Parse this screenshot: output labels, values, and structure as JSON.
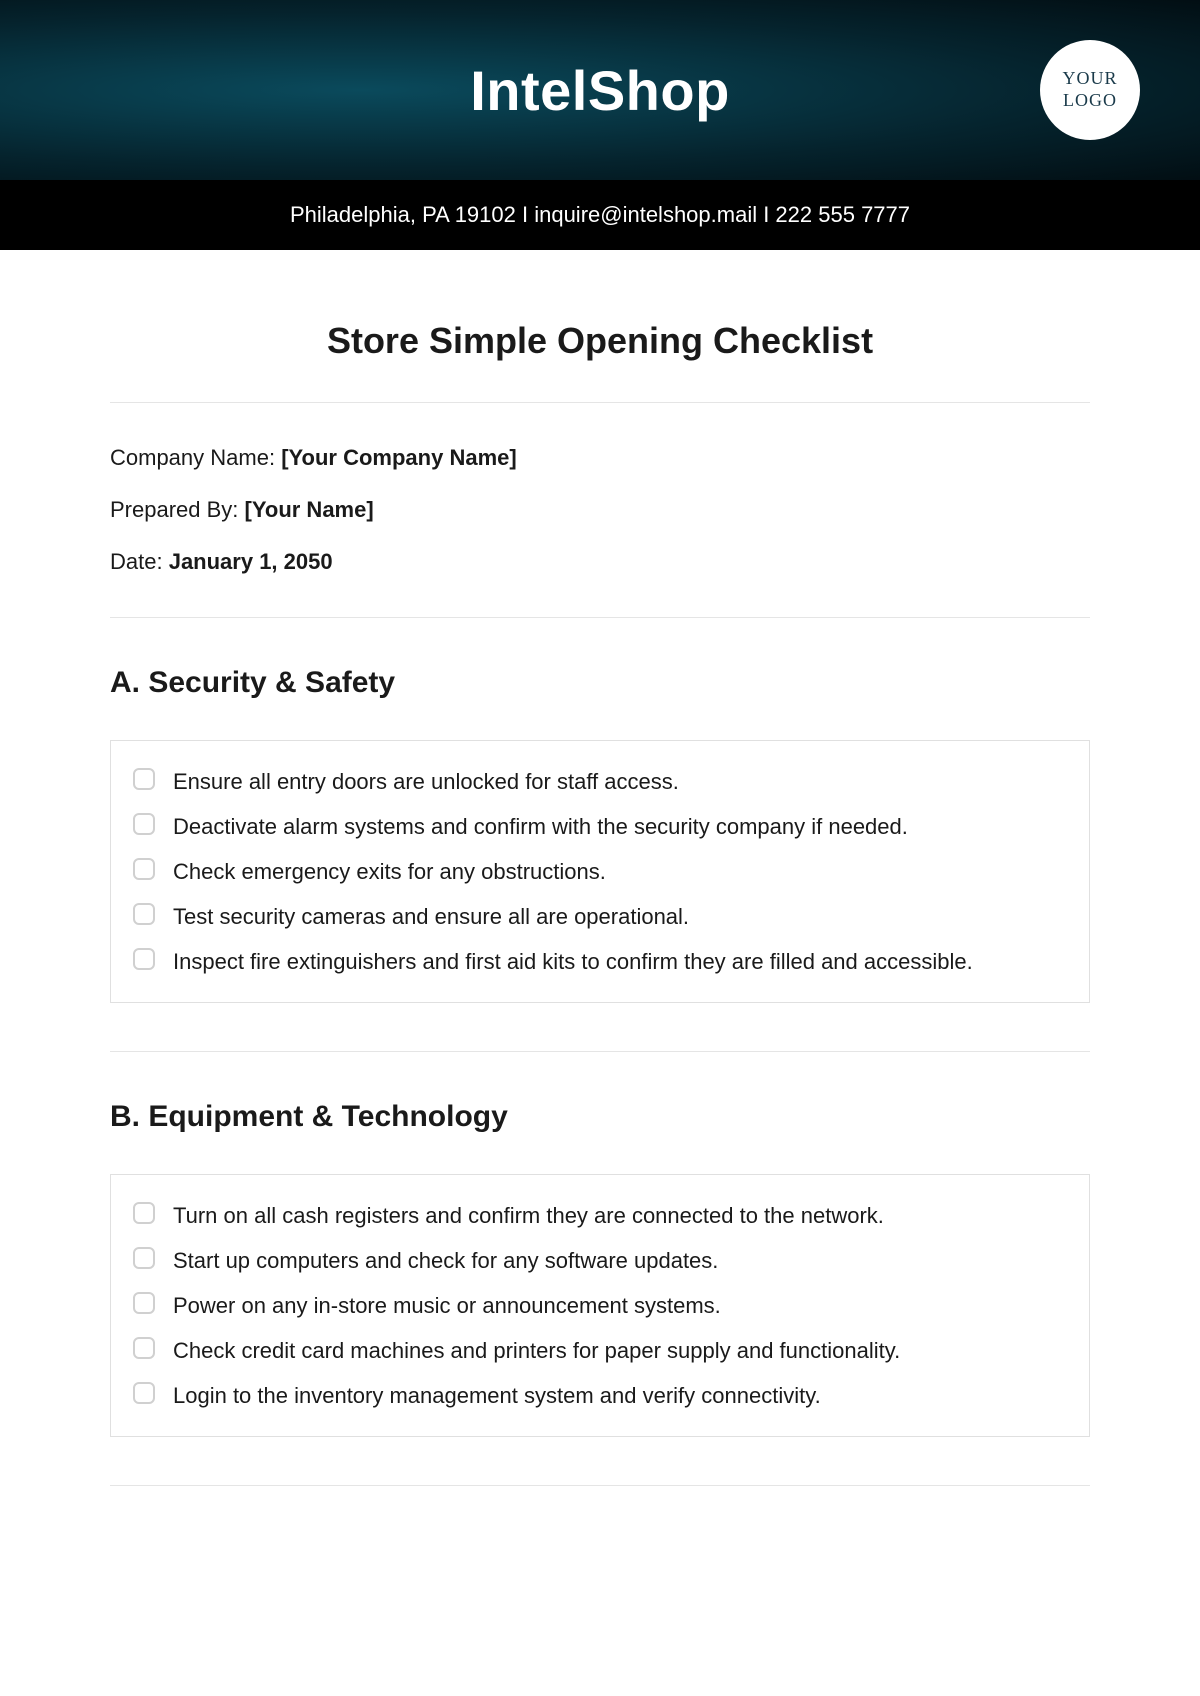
{
  "header": {
    "brand": "IntelShop",
    "logo_text": "YOUR LOGO",
    "contact": "Philadelphia, PA 19102 I inquire@intelshop.mail I 222 555 7777"
  },
  "doc_title": "Store Simple Opening Checklist",
  "meta": {
    "company_label": "Company Name: ",
    "company_value": "[Your Company Name]",
    "prepared_label": "Prepared By: ",
    "prepared_value": "[Your Name]",
    "date_label": "Date: ",
    "date_value": "January 1, 2050"
  },
  "sections": [
    {
      "title": "A. Security & Safety",
      "items": [
        "Ensure all entry doors are unlocked for staff access.",
        "Deactivate alarm systems and confirm with the security company if needed.",
        "Check emergency exits for any obstructions.",
        "Test security cameras and ensure all are operational.",
        "Inspect fire extinguishers and first aid kits to confirm they are filled and accessible."
      ]
    },
    {
      "title": "B. Equipment & Technology",
      "items": [
        "Turn on all cash registers and confirm they are connected to the network.",
        "Start up computers and check for any software updates.",
        "Power on any in-store music or announcement systems.",
        "Check credit card machines and printers for paper supply and functionality.",
        "Login to the inventory management system and verify connectivity."
      ]
    }
  ]
}
